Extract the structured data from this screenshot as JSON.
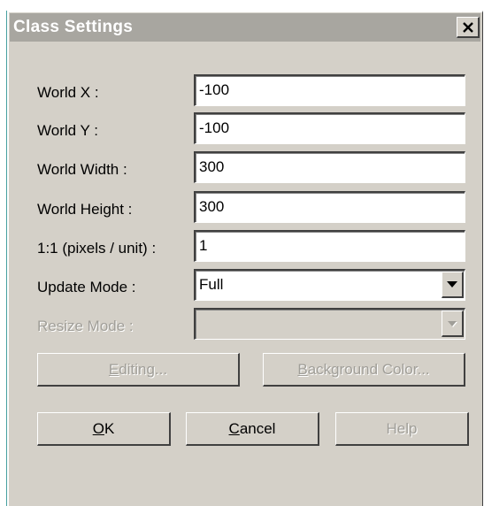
{
  "window": {
    "title": "Class Settings",
    "close_icon": "close-icon"
  },
  "fields": {
    "world_x": {
      "label": "World X :",
      "value": "-100"
    },
    "world_y": {
      "label": "World Y :",
      "value": "-100"
    },
    "world_width": {
      "label": "World Width :",
      "value": "300"
    },
    "world_height": {
      "label": "World Height :",
      "value": "300"
    },
    "pixels_per_unit": {
      "label": "1:1 (pixels / unit) :",
      "value": "1"
    },
    "update_mode": {
      "label": "Update Mode :",
      "value": "Full",
      "icon": "chevron-down-icon"
    },
    "resize_mode": {
      "label": "Resize Mode :",
      "value": "",
      "icon": "chevron-down-icon",
      "disabled": true
    }
  },
  "buttons": {
    "editing": {
      "mnemonic": "E",
      "rest": "diting...",
      "disabled": true
    },
    "background_color": {
      "mnemonic": "B",
      "rest": "ackground Color...",
      "disabled": true
    },
    "ok": {
      "mnemonic": "O",
      "rest": "K"
    },
    "cancel": {
      "mnemonic": "C",
      "rest": "ancel"
    },
    "help": {
      "label": "Help",
      "disabled": true
    }
  },
  "colors": {
    "face": "#d4d0c8",
    "title_inactive": "#a8a6a0",
    "disabled_text": "#a09e98"
  }
}
